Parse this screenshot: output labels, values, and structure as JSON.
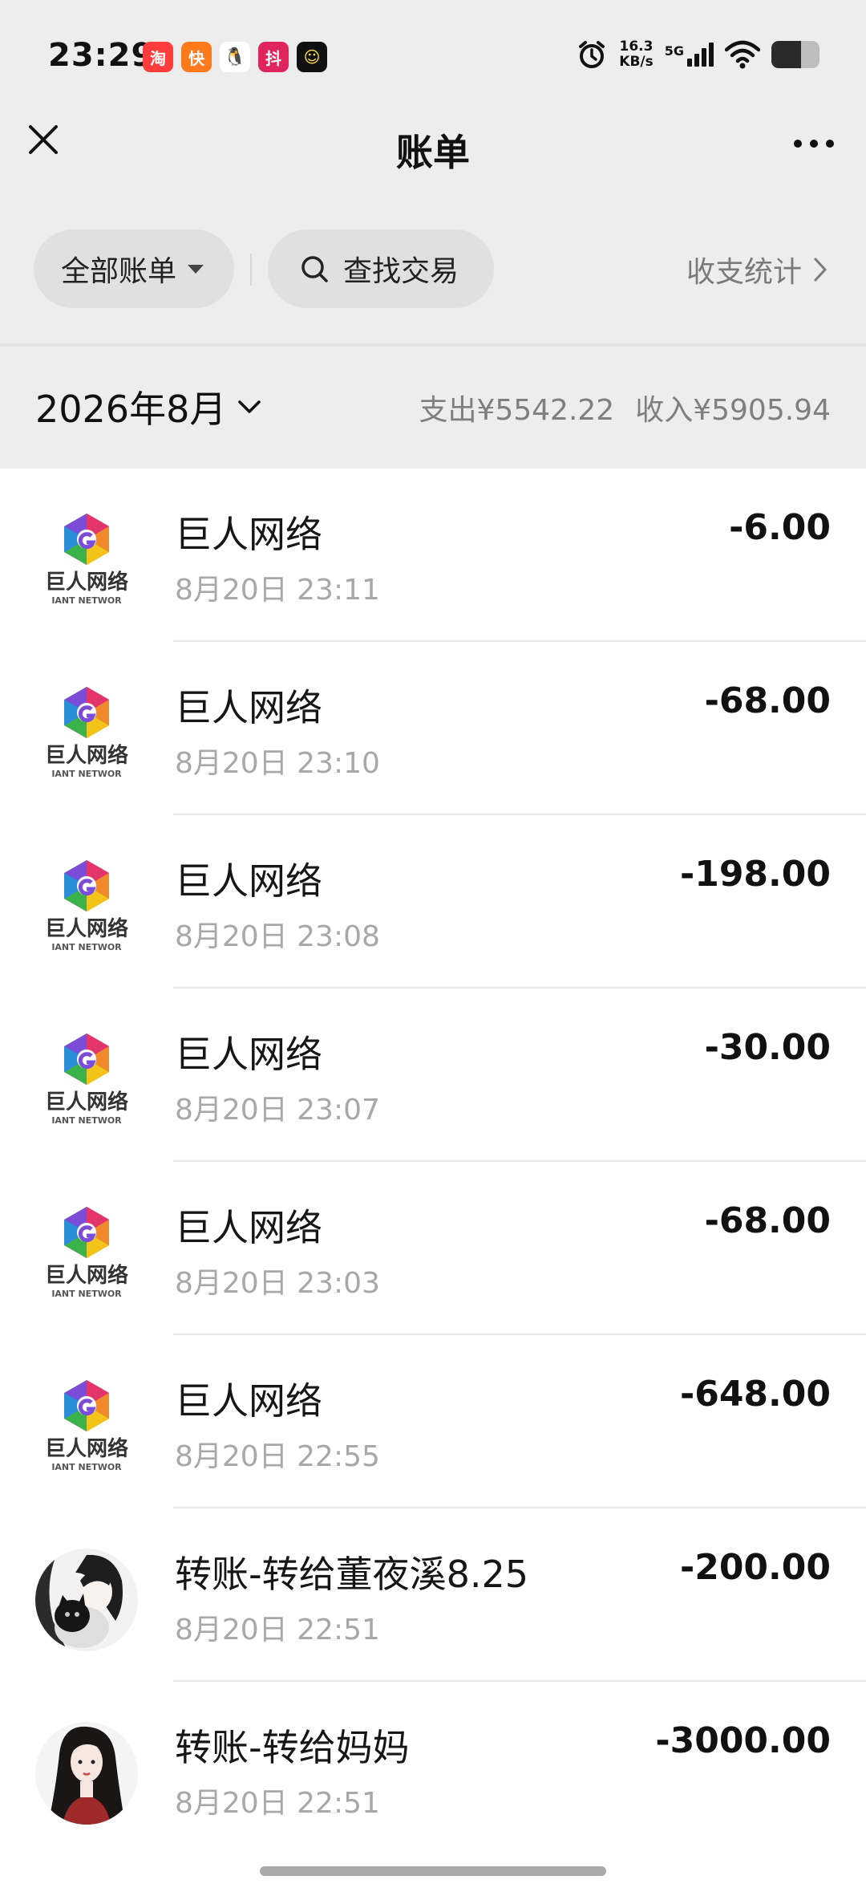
{
  "status_bar": {
    "time": "23:29",
    "apps": [
      {
        "icon": "taobao-app-icon",
        "color": "#ff3d3d",
        "glyph": "淘"
      },
      {
        "icon": "kuaishou-app-icon",
        "color": "#ff7a1a",
        "glyph": "快"
      },
      {
        "icon": "qq-app-icon",
        "color": "#ffffff",
        "glyph": "🐧"
      },
      {
        "icon": "douyin-app-icon",
        "color": "#e0245e",
        "glyph": "抖"
      },
      {
        "icon": "app-smile-icon",
        "color": "#111111",
        "glyph": "☺"
      }
    ],
    "speed_value": "16.3",
    "speed_unit": "KB/s",
    "network": "5G",
    "battery_level": 0.62
  },
  "nav": {
    "title": "账单"
  },
  "filters": {
    "all_bills": "全部账单",
    "search": "查找交易",
    "stats": "收支统计"
  },
  "month": {
    "label": "2026年8月",
    "expense": "支出¥5542.22",
    "income": "收入¥5905.94"
  },
  "transactions": [
    {
      "title": "巨人网络",
      "time": "8月20日 23:11",
      "amount": "-6.00",
      "logo": "giant-network-logo"
    },
    {
      "title": "巨人网络",
      "time": "8月20日 23:10",
      "amount": "-68.00",
      "logo": "giant-network-logo"
    },
    {
      "title": "巨人网络",
      "time": "8月20日 23:08",
      "amount": "-198.00",
      "logo": "giant-network-logo"
    },
    {
      "title": "巨人网络",
      "time": "8月20日 23:07",
      "amount": "-30.00",
      "logo": "giant-network-logo"
    },
    {
      "title": "巨人网络",
      "time": "8月20日 23:03",
      "amount": "-68.00",
      "logo": "giant-network-logo"
    },
    {
      "title": "巨人网络",
      "time": "8月20日 22:55",
      "amount": "-648.00",
      "logo": "giant-network-logo"
    },
    {
      "title": "转账-转给董夜溪8.25",
      "time": "8月20日 22:51",
      "amount": "-200.00",
      "logo": "user-avatar-cat"
    },
    {
      "title": "转账-转给妈妈",
      "time": "8月20日 22:51",
      "amount": "-3000.00",
      "logo": "user-avatar-girl"
    }
  ]
}
